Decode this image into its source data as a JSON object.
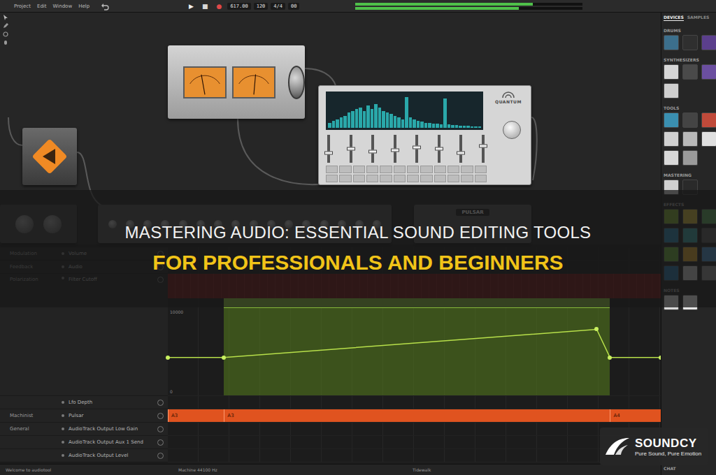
{
  "menu": [
    "Project",
    "Edit",
    "Window",
    "Help"
  ],
  "transport": {
    "buttons": [
      {
        "label": "▶",
        "selected": false,
        "color": "#f2f2f2"
      },
      {
        "label": "■",
        "selected": false,
        "color": "#d8d8d8"
      },
      {
        "label": "●",
        "selected": false,
        "color": "#e04848"
      }
    ],
    "readouts": [
      "617.00",
      "120",
      "4/4",
      "00"
    ]
  },
  "master_meter": {
    "levels": [
      0.78,
      0.72
    ]
  },
  "canvas": {
    "vu": {
      "meters": [
        {
          "level": 0.4
        },
        {
          "level": 0.55
        }
      ]
    },
    "quantum": {
      "name": "QUANTUM",
      "spectrum": [
        0.15,
        0.2,
        0.25,
        0.3,
        0.35,
        0.45,
        0.5,
        0.55,
        0.6,
        0.5,
        0.65,
        0.55,
        0.7,
        0.6,
        0.5,
        0.45,
        0.4,
        0.35,
        0.3,
        0.25,
        0.9,
        0.3,
        0.25,
        0.2,
        0.18,
        0.15,
        0.15,
        0.12,
        0.12,
        0.1,
        0.85,
        0.1,
        0.08,
        0.08,
        0.07,
        0.06,
        0.06,
        0.05,
        0.05,
        0.05
      ],
      "faders": [
        0.35,
        0.5,
        0.4,
        0.45,
        0.55,
        0.5,
        0.35,
        0.6
      ]
    },
    "pulsar": {
      "name": "PULSAR"
    }
  },
  "banner": {
    "line1": "MASTERING AUDIO: ESSENTIAL SOUND EDITING TOOLS",
    "line2": "FOR PROFESSIONALS AND BEGINNERS"
  },
  "tracks": [
    {
      "group": "Modulation",
      "param": "Volume",
      "kind": "param"
    },
    {
      "group": "Feedback",
      "param": "Audio",
      "kind": "param"
    },
    {
      "group": "Polarization",
      "param": "Filter Cutoff",
      "kind": "automation"
    },
    {
      "group": "",
      "param": "Lfo Depth",
      "kind": "param"
    },
    {
      "group": "Machinist",
      "param": "Pulsar",
      "kind": "clip"
    },
    {
      "group": "General",
      "param": "AudioTrack Output Low Gain",
      "kind": "param"
    },
    {
      "group": "",
      "param": "AudioTrack Output Aux 1 Send",
      "kind": "param"
    },
    {
      "group": "",
      "param": "AudioTrack Output Level",
      "kind": "param"
    }
  ],
  "automation": {
    "ticks": [
      "10000",
      "0"
    ],
    "region": {
      "start": 0.114,
      "end": 0.897
    },
    "points": [
      {
        "x": 0,
        "value": 3900
      },
      {
        "x": 0.114,
        "value": 3900
      },
      {
        "x": 0.87,
        "value": 6800
      },
      {
        "x": 0.897,
        "value": 3900
      },
      {
        "x": 1,
        "value": 3900
      }
    ]
  },
  "clips": [
    {
      "label": "A3",
      "start": 0
    },
    {
      "label": "A3",
      "start": 0.114
    },
    {
      "label": "A4",
      "start": 0.897
    }
  ],
  "status": [
    "Welcome to audiotool",
    "Machine 44100 Hz",
    "Tidewalk"
  ],
  "sidebar": {
    "tabs": [
      {
        "label": "DEVICES",
        "selected": true
      },
      {
        "label": "SAMPLES",
        "selected": false
      }
    ],
    "sections": [
      {
        "title": "DRUMS",
        "tiles": [
          "#3c6f8c",
          "#2f2f2f",
          "#5b3f8c"
        ]
      },
      {
        "title": "SYNTHESIZERS",
        "tiles": [
          "#d6d6d6",
          "#4a4a4a",
          "#6b4fa0",
          "#cfcfcf"
        ]
      },
      {
        "title": "TOOLS",
        "tiles": [
          "#3a8fb0",
          "#444444",
          "#c04a3a",
          "#d0d0d0",
          "#b8b8b8",
          "#e0e0e0",
          "#d8d8d8",
          "#9a9a9a"
        ]
      },
      {
        "title": "MASTERING",
        "tiles": [
          "#cfcfcf",
          "#2a2a2a"
        ]
      },
      {
        "title": "EFFECTS",
        "tiles": [
          "#7da832",
          "#c9b23a",
          "#5aa05a",
          "#2d7fa8",
          "#3a9a9a",
          "#5a5a5a",
          "#6aa83a",
          "#d0a030",
          "#4a8ac0",
          "#2a6fa0",
          "#c0c0c0",
          "#8a8a8a"
        ]
      },
      {
        "title": "NOTES",
        "tiles": [
          "#d8d8d8",
          "#e6e6e6"
        ]
      },
      {
        "title": "CHAT",
        "tiles": []
      }
    ]
  },
  "logo": {
    "name": "SOUNDCY",
    "tagline": "Pure Sound, Pure Emotion"
  }
}
